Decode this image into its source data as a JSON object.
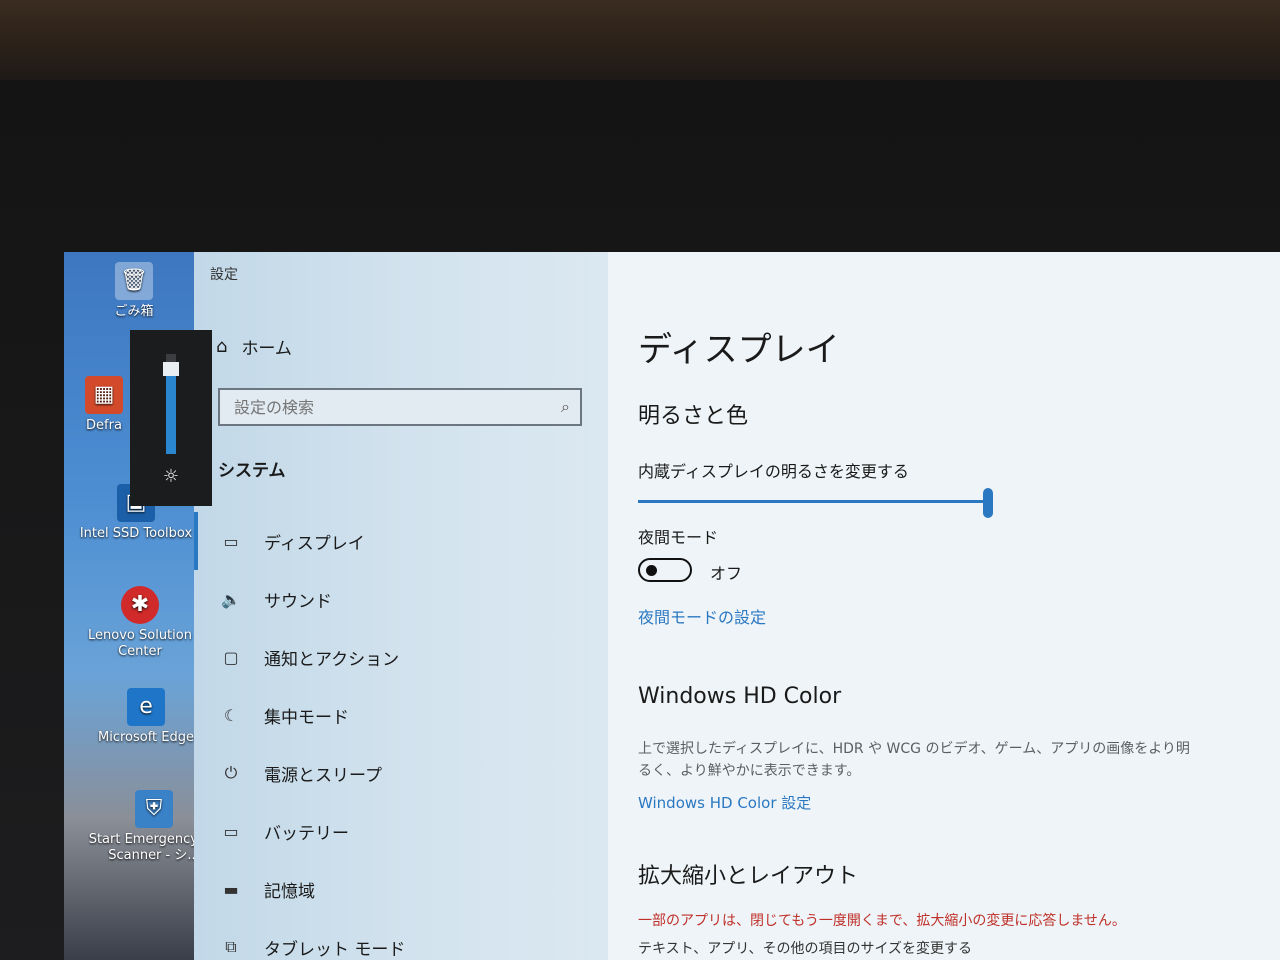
{
  "desktop": {
    "icons": [
      {
        "label": "ごみ箱",
        "icon": "recycle-bin-icon"
      },
      {
        "label": "Defra",
        "icon": "defraggler-icon"
      },
      {
        "label": "Intel SSD Toolbox",
        "icon": "intel-ssd-toolbox-icon"
      },
      {
        "label": "Lenovo Solution Center",
        "icon": "lenovo-solution-center-icon"
      },
      {
        "label": "Microsoft Edge",
        "icon": "edge-icon"
      },
      {
        "label": "Start Emergency Kit Scanner - シ...",
        "icon": "emergency-kit-icon"
      }
    ]
  },
  "brightness_flyout": {
    "level": 0.85,
    "icon": "sun-icon"
  },
  "settings": {
    "app_title": "設定",
    "home_label": "ホーム",
    "search_placeholder": "設定の検索",
    "section_title": "システム",
    "nav_items": [
      {
        "label": "ディスプレイ",
        "icon": "monitor-icon",
        "active": true
      },
      {
        "label": "サウンド",
        "icon": "speaker-icon"
      },
      {
        "label": "通知とアクション",
        "icon": "notification-icon"
      },
      {
        "label": "集中モード",
        "icon": "moon-icon"
      },
      {
        "label": "電源とスリープ",
        "icon": "power-icon"
      },
      {
        "label": "バッテリー",
        "icon": "battery-icon"
      },
      {
        "label": "記憶域",
        "icon": "storage-icon"
      },
      {
        "label": "タブレット モード",
        "icon": "tablet-icon"
      }
    ],
    "content": {
      "page_title": "ディスプレイ",
      "brightness_section": "明るさと色",
      "brightness_label": "内蔵ディスプレイの明るさを変更する",
      "brightness_value": 1.0,
      "night_mode_label": "夜間モード",
      "night_mode_state": "オフ",
      "night_mode_link": "夜間モードの設定",
      "hd_color_title": "Windows HD Color",
      "hd_color_desc": "上で選択したディスプレイに、HDR や WCG のビデオ、ゲーム、アプリの画像をより明るく、より鮮やかに表示できます。",
      "hd_color_link": "Windows HD Color 設定",
      "scale_title": "拡大縮小とレイアウト",
      "scale_warning": "一部のアプリは、閉じてもう一度開くまで、拡大縮小の変更に応答しません。",
      "scale_size_label": "テキスト、アプリ、その他の項目のサイズを変更する"
    }
  },
  "colors": {
    "accent": "#2b78c2",
    "warning": "#c0302a"
  }
}
